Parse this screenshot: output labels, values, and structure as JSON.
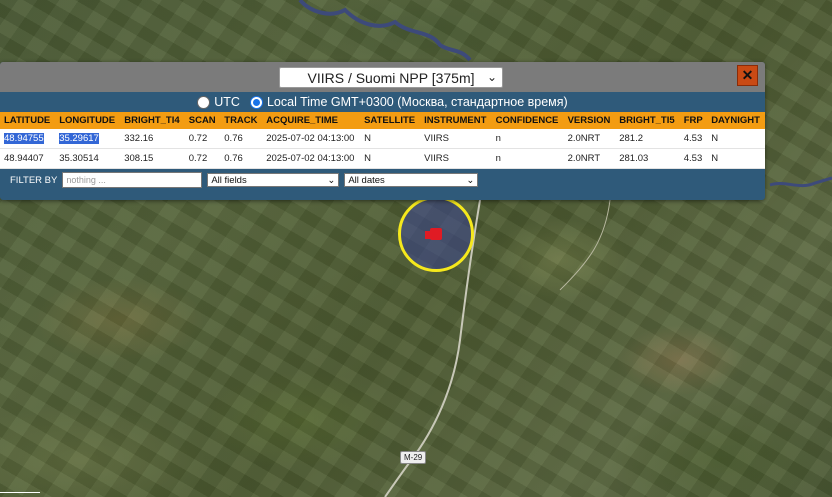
{
  "popup": {
    "source_select": "VIIRS / Suomi NPP [375m]",
    "close_label": "✕",
    "timezone": {
      "utc_label": "UTC",
      "local_label": "Local Time GMT+0300 (Москва, стандартное время)"
    },
    "columns": [
      "LATITUDE",
      "LONGITUDE",
      "BRIGHT_TI4",
      "SCAN",
      "TRACK",
      "ACQUIRE_TIME",
      "SATELLITE",
      "INSTRUMENT",
      "CONFIDENCE",
      "VERSION",
      "BRIGHT_TI5",
      "FRP",
      "DAYNIGHT"
    ],
    "rows": [
      [
        "48.94755",
        "35.29617",
        "332.16",
        "0.72",
        "0.76",
        "2025-07-02 04:13:00",
        "N",
        "VIIRS",
        "n",
        "2.0NRT",
        "281.2",
        "4.53",
        "N"
      ],
      [
        "48.94407",
        "35.30514",
        "308.15",
        "0.72",
        "0.76",
        "2025-07-02 04:13:00",
        "N",
        "VIIRS",
        "n",
        "2.0NRT",
        "281.03",
        "4.53",
        "N"
      ]
    ],
    "filter": {
      "label": "FILTER BY",
      "placeholder": "nothing ...",
      "field_select": "All fields",
      "date_select": "All dates"
    }
  },
  "map": {
    "road_label": "M-29",
    "colors": {
      "hotspot_ring": "#f5e81c",
      "fire": "#e01b24",
      "popup_bg": "#2f5a7a",
      "header_accent": "#f39c12"
    }
  }
}
